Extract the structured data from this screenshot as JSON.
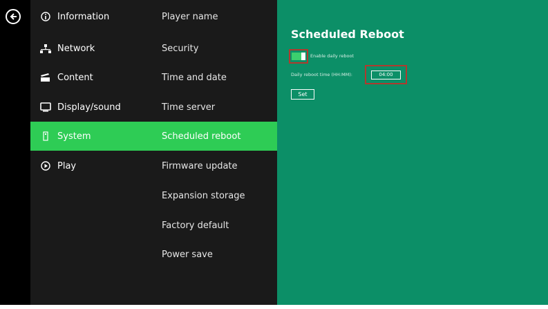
{
  "categories": [
    {
      "label": "Information",
      "icon": "info-icon"
    },
    {
      "label": "Network",
      "icon": "network-icon"
    },
    {
      "label": "Content",
      "icon": "content-icon"
    },
    {
      "label": "Display/sound",
      "icon": "display-icon"
    },
    {
      "label": "System",
      "icon": "system-icon",
      "active": true
    },
    {
      "label": "Play",
      "icon": "play-icon"
    }
  ],
  "submenu": [
    {
      "label": "Player name"
    },
    {
      "label": "Security"
    },
    {
      "label": "Time and date"
    },
    {
      "label": "Time server"
    },
    {
      "label": "Scheduled reboot",
      "active": true
    },
    {
      "label": "Firmware update"
    },
    {
      "label": "Expansion storage"
    },
    {
      "label": "Factory default"
    },
    {
      "label": "Power save"
    }
  ],
  "panel": {
    "title": "Scheduled Reboot",
    "enable_label": "Enable daily reboot",
    "enable_on": true,
    "time_label": "Daily reboot time (HH:MM):",
    "time_value": "04:00",
    "set_label": "Set"
  },
  "colors": {
    "active": "#2ecc55",
    "panel": "#0c8f67",
    "highlight_border": "#b03a2e",
    "sidebar": "#1a1a1a"
  }
}
